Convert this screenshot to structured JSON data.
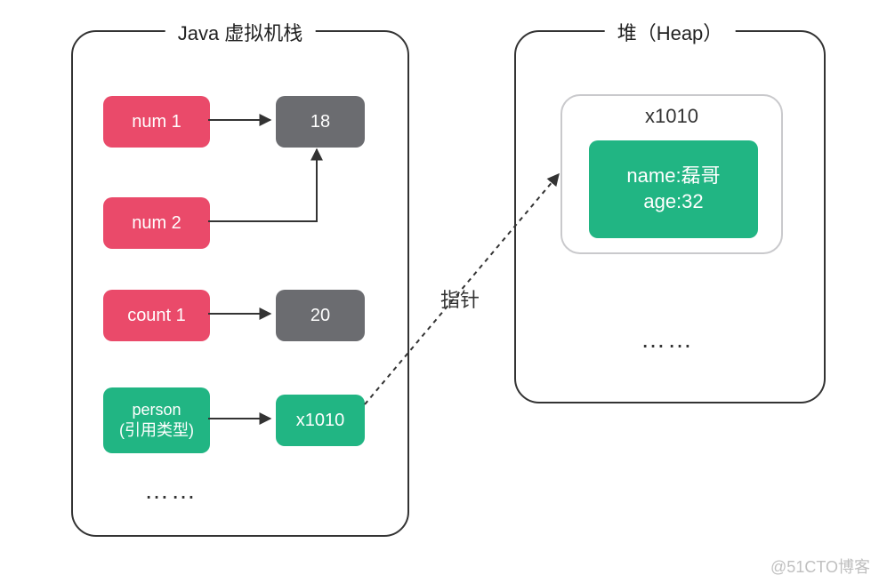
{
  "stack": {
    "title": "Java 虚拟机栈",
    "num1": "num 1",
    "num2": "num 2",
    "count1": "count 1",
    "person": "person\n(引用类型)",
    "val18": "18",
    "val20": "20",
    "refAddr": "x1010",
    "dots": "……"
  },
  "pointer_label": "指针",
  "heap": {
    "title": "堆（Heap）",
    "objAddr": "x1010",
    "objContent": "name:磊哥\nage:32",
    "dots": "……"
  },
  "watermark": "@51CTO博客"
}
